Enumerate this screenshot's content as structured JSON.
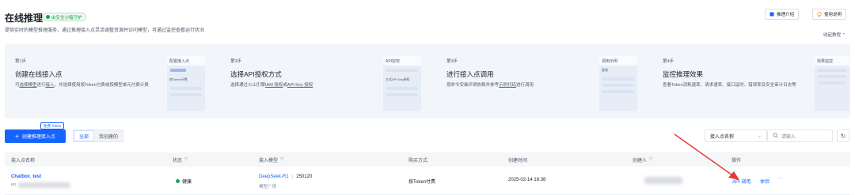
{
  "header": {
    "title": "在线推理",
    "badge": "由安全沙箱守护",
    "subtitle": "提供实时的模型推理服务，通过推理接入点灵活调整资源并访问模型，可通过监控查看运行状况",
    "intro_button": "推理介绍",
    "guide_button": "使用说明",
    "collapse": "收起教程"
  },
  "steps": [
    {
      "no": "第1步",
      "title": "创建在线接入点",
      "desc_parts": [
        "可",
        "选择模型",
        "进行",
        "接入",
        "，并选择使用按Token付费或按模型单元付费计费"
      ],
      "thumb": "配置接入点",
      "thumb_item": "按Token计费"
    },
    {
      "no": "第2步",
      "title": "选择API授权方式",
      "desc_parts": [
        "选择通过火山引擎",
        "IAM 授权",
        "或",
        "API Key 授权"
      ],
      "thumb": "API授权",
      "thumb_item": "方式API Key授权"
    },
    {
      "no": "第3步",
      "title": "进行接入点调用",
      "desc_parts": [
        "按命令安装环境依赖并参考",
        "示例代码",
        "进行调用"
      ],
      "thumb": "调用示例",
      "thumb_item": "复制"
    },
    {
      "no": "第4步",
      "title": "监控推理效果",
      "desc_parts": [
        "查看Token消耗速率、请求速率、接口延时、错误率及安全审计日志等"
      ],
      "thumb": "效果监控",
      "thumb_item": ""
    }
  ],
  "toolbar": {
    "create": "创建推理接入点",
    "free_tag": "免费 Token",
    "tabs": [
      "全部",
      "我创建的"
    ],
    "filter_select": "接入点名称",
    "search_placeholder": "请输入"
  },
  "table": {
    "columns": [
      "接入点名称",
      "状态",
      "接入模型",
      "购买方式",
      "创建时间",
      "创建人",
      "操作"
    ],
    "row": {
      "name": "Chatbox_test",
      "id_prefix": "ep",
      "status": "健康",
      "model": "DeepSeek-R1",
      "version": "250120",
      "model_source": "模型广场",
      "purchase": "按Token付费",
      "created": "2025-02-14 16:38",
      "actions": [
        "API 调用",
        "体验",
        "···"
      ]
    }
  },
  "colors": {
    "primary": "#1664ff",
    "success": "#14a85a",
    "annotation_arrow": "#e53935"
  }
}
